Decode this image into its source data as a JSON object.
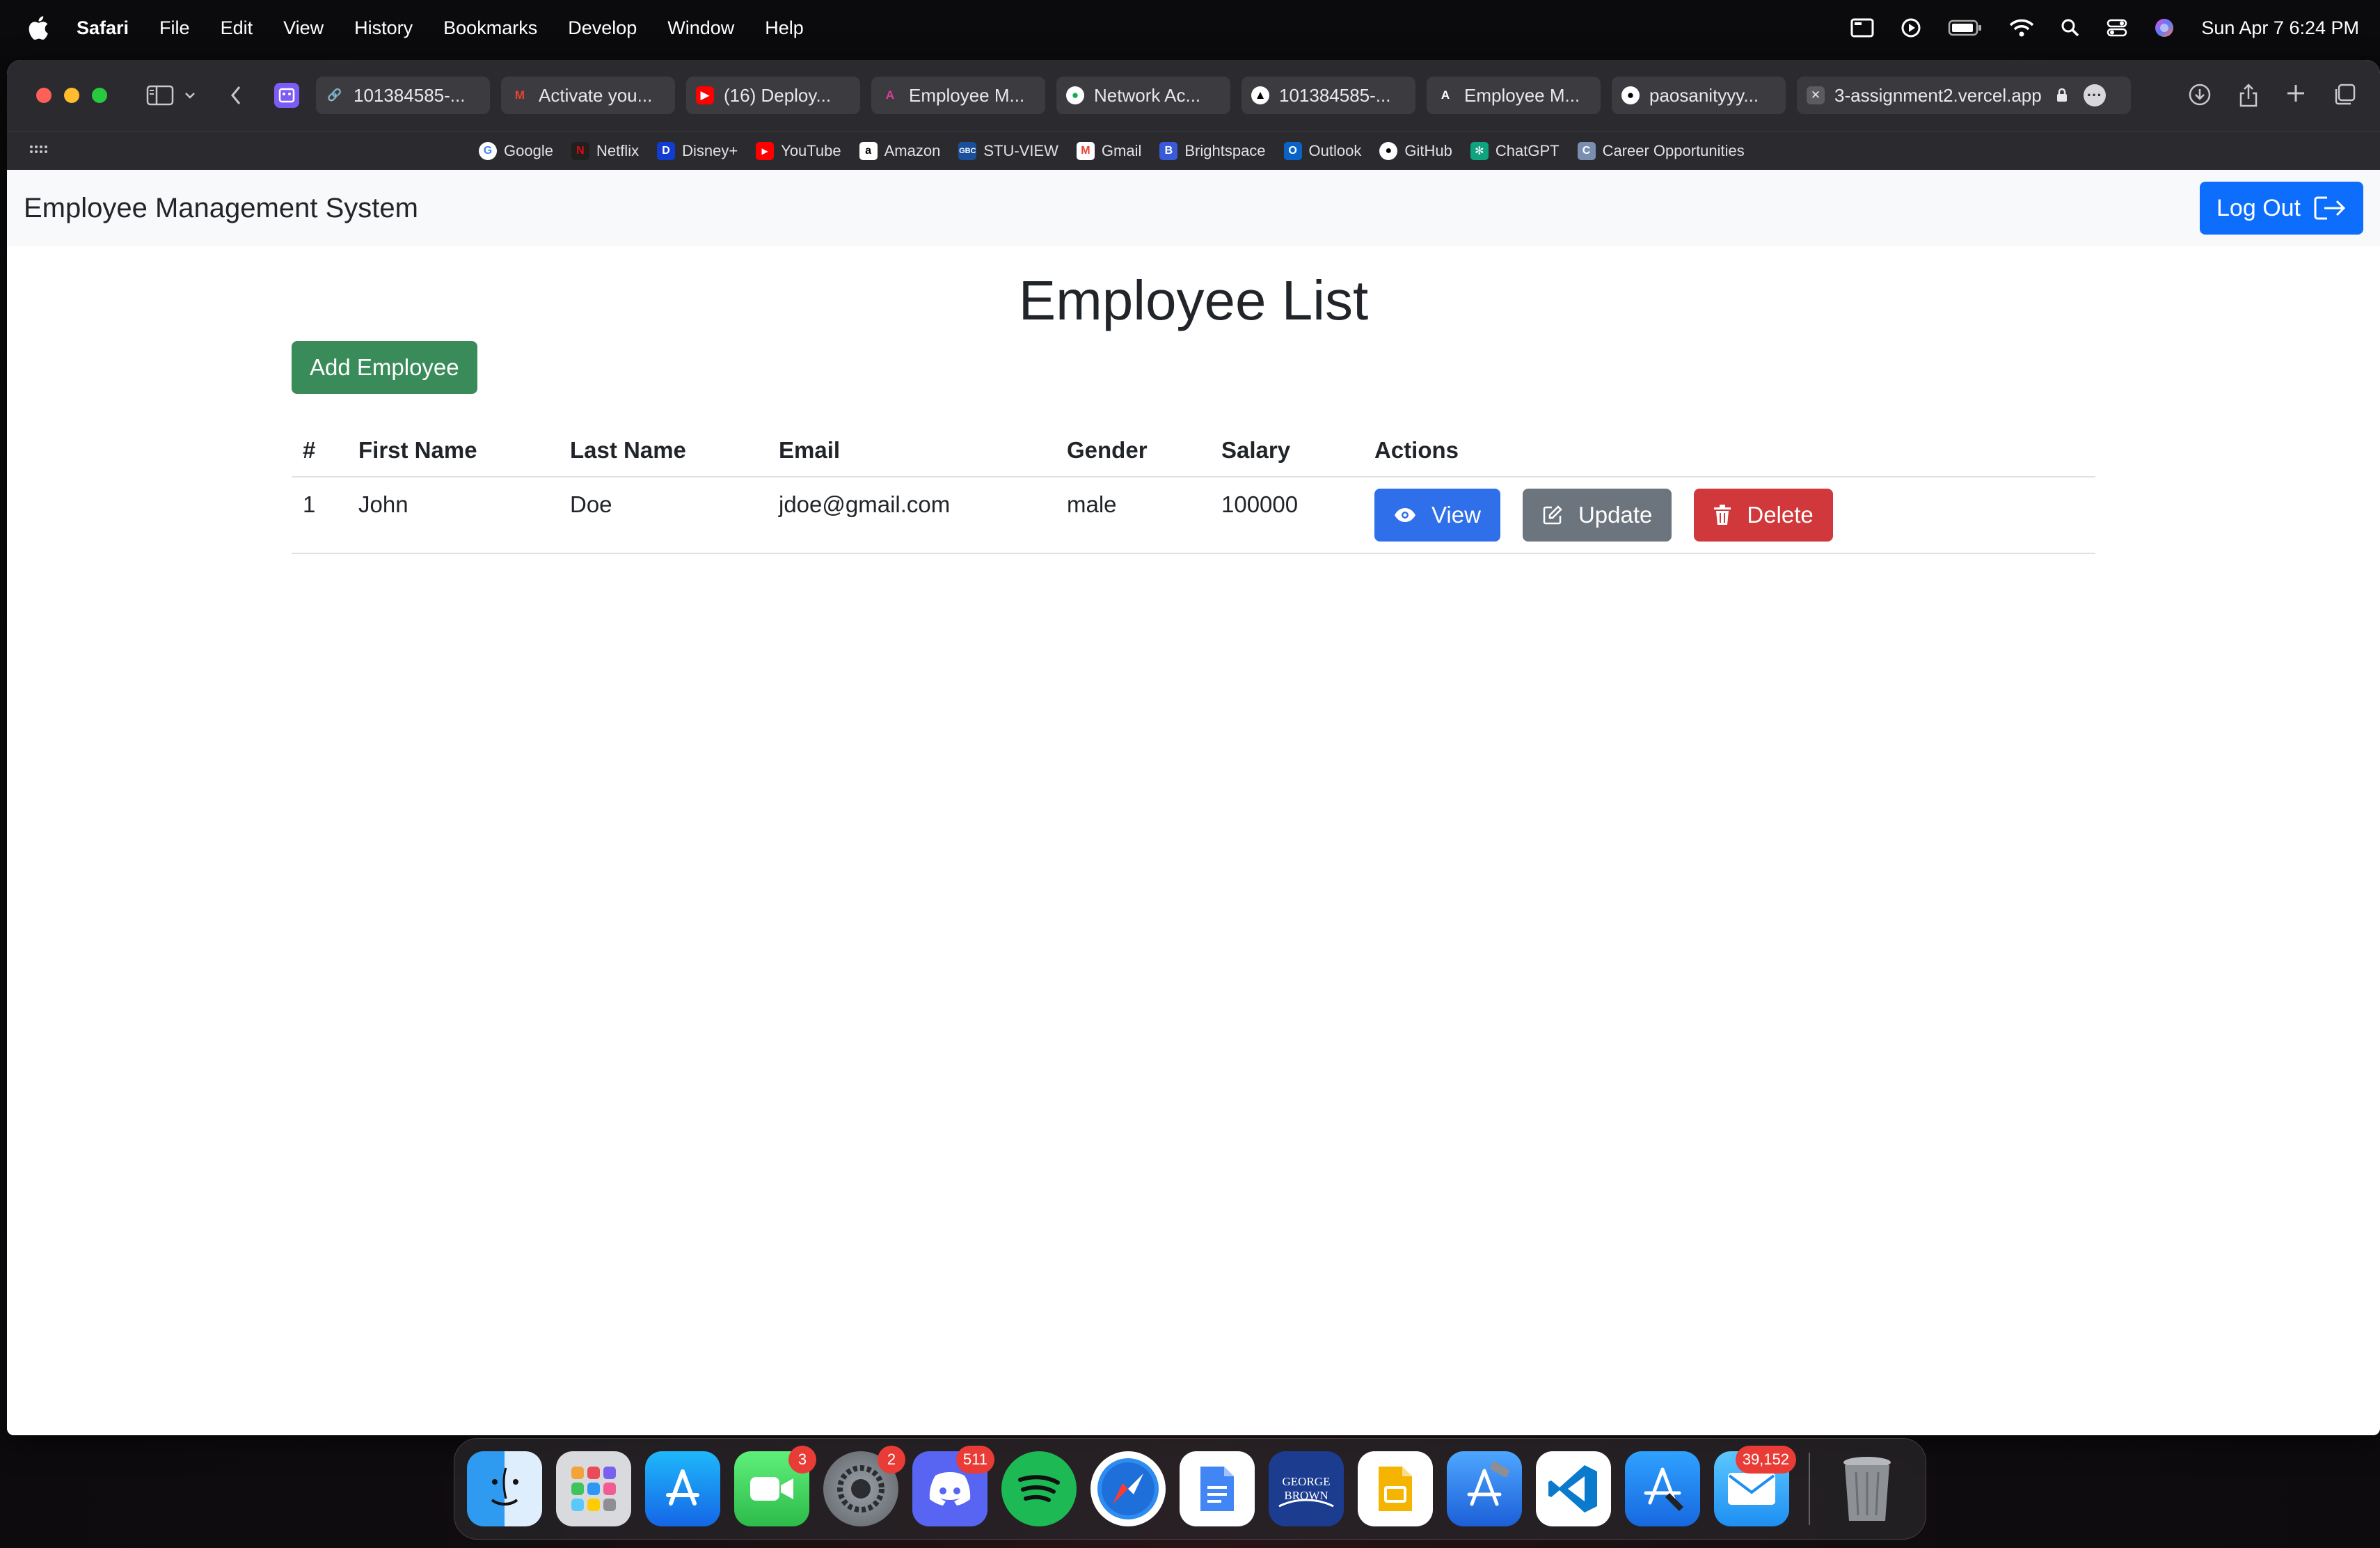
{
  "menubar": {
    "app": "Safari",
    "items": [
      "File",
      "Edit",
      "View",
      "History",
      "Bookmarks",
      "Develop",
      "Window",
      "Help"
    ],
    "clock": "Sun Apr 7  6:24 PM"
  },
  "tabs": [
    {
      "label": "101384585-...",
      "icon": "link-icon",
      "color": "#3c3b40"
    },
    {
      "label": "Activate you...",
      "icon": "gmail-icon",
      "color": "#3c3b40"
    },
    {
      "label": "(16) Deploy...",
      "icon": "youtube-icon",
      "color": "#3c3b40"
    },
    {
      "label": "Employee M...",
      "icon": "angular-icon",
      "color": "#3c3b40"
    },
    {
      "label": "Network Ac...",
      "icon": "mongodb-icon",
      "color": "#3c3b40"
    },
    {
      "label": "101384585-...",
      "icon": "vercel-icon",
      "color": "#3c3b40"
    },
    {
      "label": "Employee M...",
      "icon": "angular-a-icon",
      "color": "#3c3b40"
    },
    {
      "label": "paosanityyy...",
      "icon": "github-icon",
      "color": "#3c3b40"
    }
  ],
  "active_tab": {
    "label": "3-assignment2.vercel.app"
  },
  "bookmarks": [
    {
      "label": "Google",
      "color": "#ffffff"
    },
    {
      "label": "Netflix",
      "color": "#e50914"
    },
    {
      "label": "Disney+",
      "color": "#113ccf"
    },
    {
      "label": "YouTube",
      "color": "#ff0000"
    },
    {
      "label": "Amazon",
      "color": "#ffffff"
    },
    {
      "label": "STU-VIEW",
      "color": "#1b4f9c"
    },
    {
      "label": "Gmail",
      "color": "#ffffff"
    },
    {
      "label": "Brightspace",
      "color": "#3a5bd9"
    },
    {
      "label": "Outlook",
      "color": "#0a64c8"
    },
    {
      "label": "GitHub",
      "color": "#ffffff"
    },
    {
      "label": "ChatGPT",
      "color": "#10a37f"
    },
    {
      "label": "Career Opportunities",
      "color": "#7a8fb0"
    }
  ],
  "navbar": {
    "brand": "Employee Management System",
    "logout_label": "Log Out"
  },
  "main": {
    "title": "Employee List",
    "add_label": "Add Employee",
    "columns": [
      "#",
      "First Name",
      "Last Name",
      "Email",
      "Gender",
      "Salary",
      "Actions"
    ],
    "rows": [
      {
        "index": "1",
        "first_name": "John",
        "last_name": "Doe",
        "email": "jdoe@gmail.com",
        "gender": "male",
        "salary": "100000"
      }
    ],
    "actions": {
      "view": "View",
      "update": "Update",
      "delete": "Delete"
    }
  },
  "dock": {
    "badges": {
      "facetime": "3",
      "settings": "2",
      "discord": "511",
      "mail": "39,152"
    }
  },
  "colors": {
    "primary": "#0d6efd",
    "success": "#3a8b5a",
    "secondary": "#6c757d",
    "danger": "#d0383c"
  }
}
